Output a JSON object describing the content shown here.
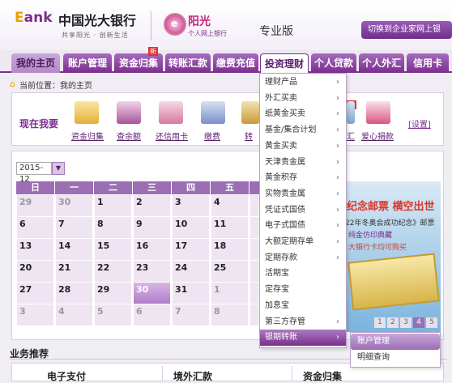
{
  "header": {
    "logo_mark_prefix": "E",
    "logo_mark_rest": "ank",
    "bank_name": "中国光大银行",
    "slogan": "共享阳光 · 创新生活",
    "badge_letter": "e",
    "badge_title": "阳光",
    "badge_sub": "个人网上银行",
    "version": "专业版",
    "switch_button": "切换到企业家网上银"
  },
  "nav": {
    "items": [
      "我的主页",
      "账户管理",
      "资金归集",
      "转账汇款",
      "缴费充值",
      "投资理财",
      "个人贷款",
      "个人外汇",
      "信用卡"
    ],
    "new_tag": "新",
    "active": "投资理财"
  },
  "breadcrumb": "当前位置：我的主页",
  "quick_panel": {
    "title": "现在我要",
    "items": [
      "资金归集",
      "查余额",
      "还信用卡",
      "缴费",
      "转"
    ],
    "new_tag": "新",
    "item_extra_1": "汇",
    "item_extra_2": "爱心捐款",
    "settings_link": "[设置]"
  },
  "calendar": {
    "month": "2015-12",
    "weekdays": [
      "日",
      "一",
      "二",
      "三",
      "四",
      "五"
    ],
    "rows": [
      [
        "29",
        "30",
        "1",
        "2",
        "3",
        "4"
      ],
      [
        "6",
        "7",
        "8",
        "9",
        "10",
        "11"
      ],
      [
        "13",
        "14",
        "15",
        "16",
        "17",
        "18"
      ],
      [
        "20",
        "21",
        "22",
        "23",
        "24",
        "25"
      ],
      [
        "27",
        "28",
        "29",
        "30",
        "31",
        "1"
      ],
      [
        "3",
        "4",
        "5",
        "6",
        "7",
        "8"
      ]
    ],
    "selected": "30"
  },
  "promo": {
    "title": "纪念邮票 横空出世",
    "line1": "22年冬奥会成功纪念》邮票",
    "line2": "纯金仿印典藏",
    "line3": "大银行卡均可购买",
    "pages": [
      "1",
      "2",
      "3",
      "4",
      "5"
    ],
    "active_page": "4"
  },
  "dropdown": {
    "items": [
      {
        "label": "理财产品",
        "arrow": true
      },
      {
        "label": "外汇买卖",
        "arrow": true
      },
      {
        "label": "纸黄金买卖",
        "arrow": true
      },
      {
        "label": "基金/集合计划",
        "arrow": true
      },
      {
        "label": "黄金买卖",
        "arrow": true
      },
      {
        "label": "天津贵金属",
        "arrow": true
      },
      {
        "label": "黄金积存",
        "arrow": true
      },
      {
        "label": "实物贵金属",
        "arrow": true
      },
      {
        "label": "凭证式国债",
        "arrow": true
      },
      {
        "label": "电子式国债",
        "arrow": true
      },
      {
        "label": "大额定期存单",
        "arrow": true
      },
      {
        "label": "定期存款",
        "arrow": true
      },
      {
        "label": "活期宝",
        "arrow": false
      },
      {
        "label": "定存宝",
        "arrow": false
      },
      {
        "label": "加息宝",
        "arrow": false
      },
      {
        "label": "第三方存管",
        "arrow": true
      },
      {
        "label": "银期转账",
        "arrow": true
      }
    ],
    "highlighted": "银期转账",
    "arrow_glyph": "›"
  },
  "submenu": {
    "items": [
      "账户管理",
      "明细查询"
    ],
    "highlighted": "账户管理"
  },
  "business": {
    "title": "业务推荐",
    "items": [
      "电子支付",
      "境外汇款",
      "资金归集"
    ]
  },
  "colors": {
    "brand_purple": "#7b2e8c",
    "accent_gold": "#e8a100",
    "alert_red": "#e2342c"
  }
}
